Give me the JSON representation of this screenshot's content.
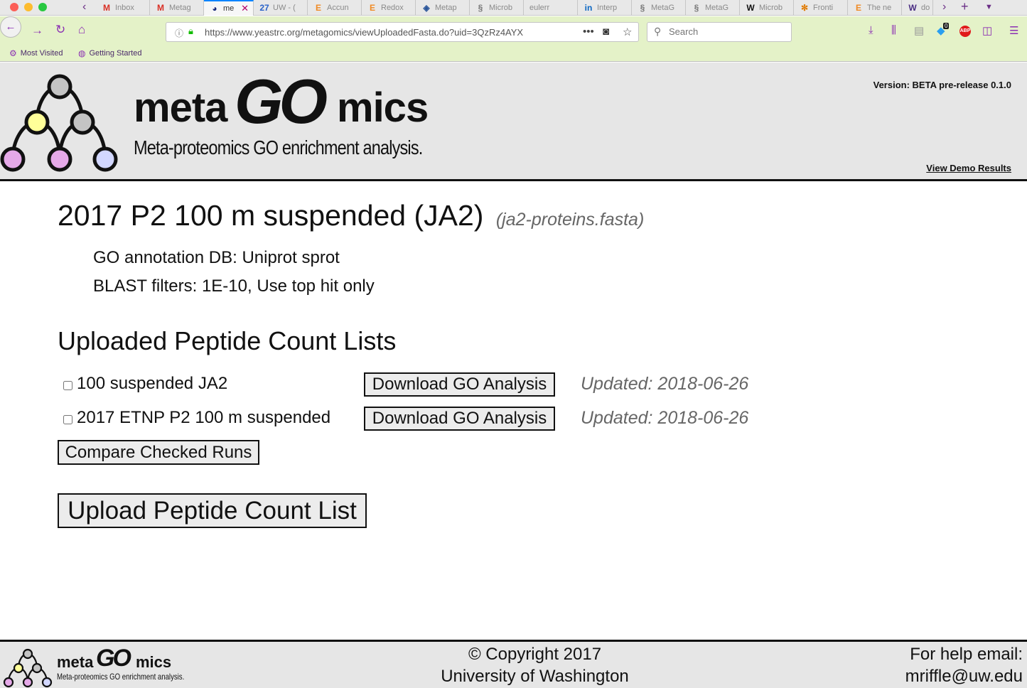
{
  "browser": {
    "tabs": [
      {
        "label": "Inbox",
        "icon": "gmail-icon"
      },
      {
        "label": "Metag",
        "icon": "gmail-icon"
      },
      {
        "label": "me",
        "icon": "yrc-icon",
        "active": true
      },
      {
        "label": "UW - (",
        "icon": "calendar-icon"
      },
      {
        "label": "Accun",
        "icon": "e-icon"
      },
      {
        "label": "Redox",
        "icon": "e-icon"
      },
      {
        "label": "Metap",
        "icon": "ship-icon"
      },
      {
        "label": "Microb",
        "icon": "link-icon"
      },
      {
        "label": "eulerr",
        "icon": ""
      },
      {
        "label": "Interp",
        "icon": "linkedin-icon"
      },
      {
        "label": "MetaG",
        "icon": "link-icon"
      },
      {
        "label": "MetaG",
        "icon": "link-icon"
      },
      {
        "label": "Microb",
        "icon": "wiley-icon"
      },
      {
        "label": "Fronti",
        "icon": "frontiers-icon"
      },
      {
        "label": "The ne",
        "icon": "e-icon"
      },
      {
        "label": "do",
        "icon": "uw-icon"
      }
    ],
    "url": "https://www.yeastrc.org/metagomics/viewUploadedFasta.do?uid=3QzRz4AYX",
    "search_placeholder": "Search",
    "notification_count": "0",
    "bookmarks": [
      "Most Visited",
      "Getting Started"
    ]
  },
  "header": {
    "logo_meta": "meta",
    "logo_go": "GO",
    "logo_mics": "mics",
    "tagline": "Meta-proteomics GO enrichment analysis.",
    "version": "Version: BETA pre-release 0.1.0",
    "demo_link": "View Demo Results",
    "logo_colors": {
      "gray": "#c4c4c4",
      "yellow": "#ffff99",
      "pink": "#e5a9e8",
      "lavender": "#d2d7ff"
    }
  },
  "main": {
    "title": "2017 P2 100 m suspended (JA2)",
    "file_name": "(ja2-proteins.fasta)",
    "go_db": "GO annotation DB: Uniprot sprot",
    "blast_filters": "BLAST filters: 1E-10, Use top hit only",
    "section_heading": "Uploaded Peptide Count Lists",
    "runs": [
      {
        "name": "100 suspended JA2",
        "download_label": "Download GO Analysis",
        "updated": "Updated: 2018-06-26",
        "checked": false
      },
      {
        "name": "2017 ETNP P2 100 m suspended",
        "download_label": "Download GO Analysis",
        "updated": "Updated: 2018-06-26",
        "checked": false
      }
    ],
    "compare_label": "Compare Checked Runs",
    "upload_label": "Upload Peptide Count List"
  },
  "footer": {
    "logo_meta": "meta",
    "logo_go": "GO",
    "logo_mics": "mics",
    "tagline": "Meta-proteomics GO enrichment analysis.",
    "copyright_line1": "© Copyright 2017",
    "copyright_line2": "University of Washington",
    "help_line1": "For help email:",
    "help_line2": "mriffle@uw.edu"
  }
}
